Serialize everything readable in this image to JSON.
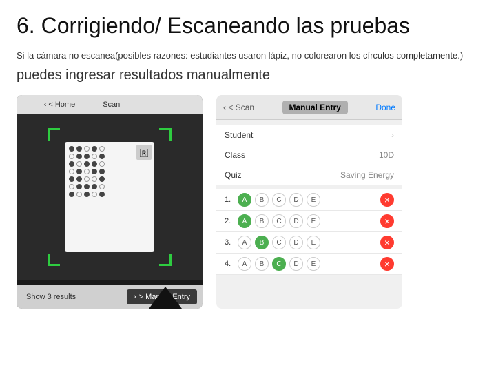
{
  "title": "6. Corrigiendo/ Escaneando las pruebas",
  "subtitle_part1": "Si la cámara no escanea",
  "subtitle_paren": "(posibles razones: estudiantes usaron lápiz, no colorearon los círculos completamente.)",
  "subtitle_large": " puedes ingresar resultados manualmente",
  "left_phone": {
    "topbar_back": "< Home",
    "topbar_scan": "Scan",
    "bottom_show": "Show 3 results",
    "bottom_manual": "> Manual Entry"
  },
  "right_phone": {
    "topbar_scan": "< Scan",
    "topbar_manual": "Manual Entry",
    "topbar_done": "Done",
    "student_label": "Student",
    "class_label": "Class",
    "class_value": "10D",
    "quiz_label": "Quiz",
    "quiz_value": "Saving Energy",
    "answers": [
      {
        "num": "1.",
        "choices": [
          "A",
          "B",
          "C",
          "D",
          "E"
        ],
        "selected": 0
      },
      {
        "num": "2.",
        "choices": [
          "A",
          "B",
          "C",
          "D",
          "E"
        ],
        "selected": 0
      },
      {
        "num": "3.",
        "choices": [
          "A",
          "B",
          "C",
          "D",
          "E"
        ],
        "selected": 1
      },
      {
        "num": "4.",
        "choices": [
          "A",
          "B",
          "C",
          "D",
          "E"
        ],
        "selected": 2
      }
    ]
  },
  "colors": {
    "green": "#2ecc40",
    "blue": "#007AFF",
    "red": "#ff3b30",
    "answer_green": "#4CAF50"
  }
}
